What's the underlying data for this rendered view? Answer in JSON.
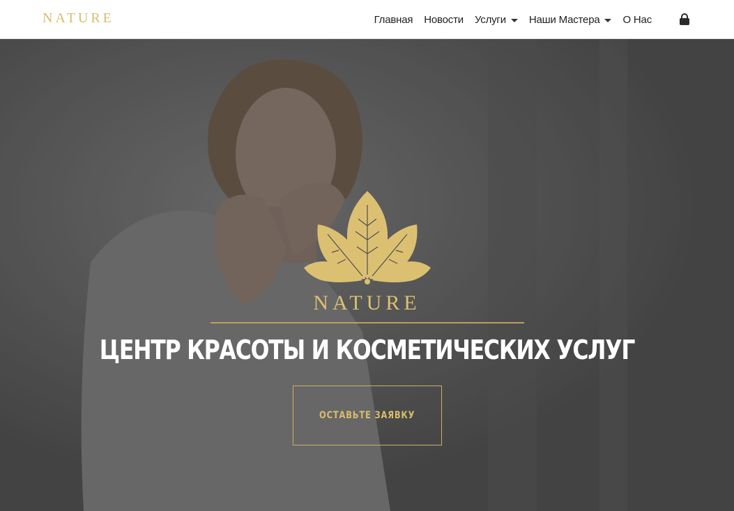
{
  "brand": {
    "name": "NATURE"
  },
  "nav": {
    "items": [
      {
        "label": "Главная"
      },
      {
        "label": "Новости"
      },
      {
        "label": "Услуги"
      },
      {
        "label": "Наши Мастера"
      },
      {
        "label": "О Нас"
      }
    ],
    "lock_icon": "lock-icon"
  },
  "hero": {
    "logo_text": "NATURE",
    "logo_icon": "lotus-leaf-icon",
    "title": "ЦЕНТР КРАСОТЫ И КОСМЕТИЧЕСКИХ УСЛУГ",
    "cta_label": "ОСТАВЬТЕ ЗАЯВКУ"
  },
  "colors": {
    "gold": "#d9bc6c",
    "overlay": "#4d4d4d",
    "nav_text": "#212121"
  }
}
